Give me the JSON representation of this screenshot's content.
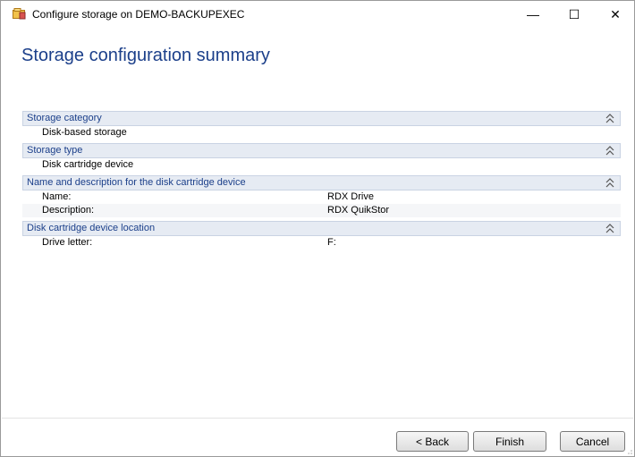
{
  "window": {
    "title": "Configure storage on DEMO-BACKUPEXEC",
    "controls": {
      "minimize": "—",
      "maximize": "☐",
      "close": "✕"
    },
    "icon": "storage-app-icon"
  },
  "page": {
    "title": "Storage configuration summary"
  },
  "sections": [
    {
      "title": "Storage category",
      "rows": [
        {
          "key": "Disk-based storage",
          "value": ""
        }
      ]
    },
    {
      "title": "Storage type",
      "rows": [
        {
          "key": "Disk cartridge device",
          "value": ""
        }
      ]
    },
    {
      "title": "Name and description for the disk cartridge device",
      "rows": [
        {
          "key": "Name:",
          "value": "RDX Drive"
        },
        {
          "key": "Description:",
          "value": "RDX QuikStor"
        }
      ]
    },
    {
      "title": "Disk cartridge device location",
      "rows": [
        {
          "key": "Drive letter:",
          "value": "F:"
        }
      ]
    }
  ],
  "buttons": {
    "back": "< Back",
    "finish": "Finish",
    "cancel": "Cancel"
  },
  "colors": {
    "accent": "#1b3f8a",
    "section_header_bg": "#e6ebf3"
  }
}
